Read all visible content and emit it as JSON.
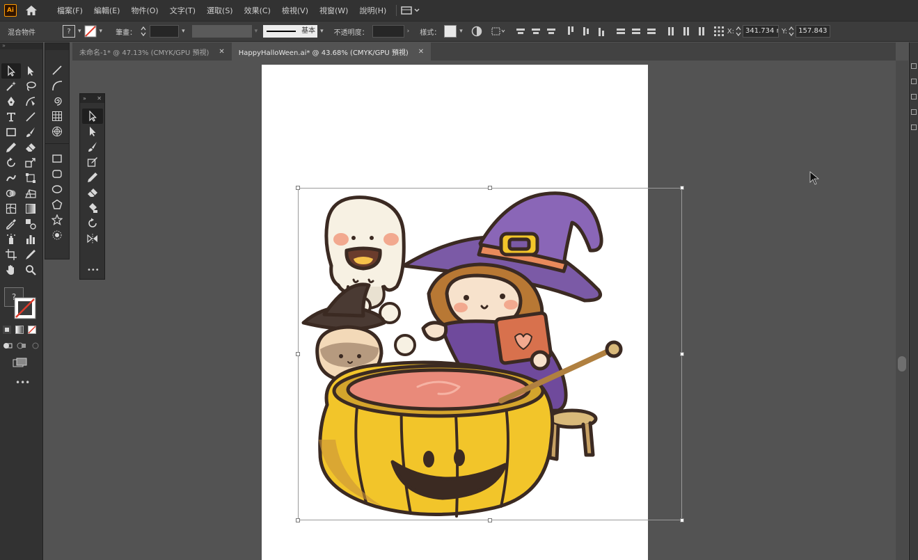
{
  "app": {
    "logo": "Ai",
    "home_icon": "home-icon"
  },
  "menu": {
    "items": [
      "檔案(F)",
      "編輯(E)",
      "物件(O)",
      "文字(T)",
      "選取(S)",
      "效果(C)",
      "檢視(V)",
      "視窗(W)",
      "說明(H)"
    ]
  },
  "control": {
    "mode_label": "混合物件",
    "stroke_label": "筆畫：",
    "stroke_style": "基本",
    "opacity_label": "不透明度：",
    "style_label": "樣式：",
    "x_label": "X:",
    "x_value": "341.734 r",
    "y_label": "Y:",
    "y_value": "157.843 r"
  },
  "tabs": [
    {
      "label": "未命名-1* @ 47.13% (CMYK/GPU 預視)",
      "active": false
    },
    {
      "label": "HappyHalloWeen.ai* @ 43.68% (CMYK/GPU 預視)",
      "active": true
    }
  ],
  "colors": {
    "menubar": "#323232",
    "controlbar": "#3c3c3c",
    "canvas": "#535353",
    "artboard": "#ffffff",
    "witch_hat": "#7b5aa6",
    "pumpkin": "#f2c52a",
    "potion": "#e98a7a",
    "outline": "#3b2a22"
  },
  "artwork": {
    "subjects": [
      "ghost",
      "witch-girl",
      "black-cat",
      "pumpkin-cauldron",
      "stool"
    ]
  }
}
